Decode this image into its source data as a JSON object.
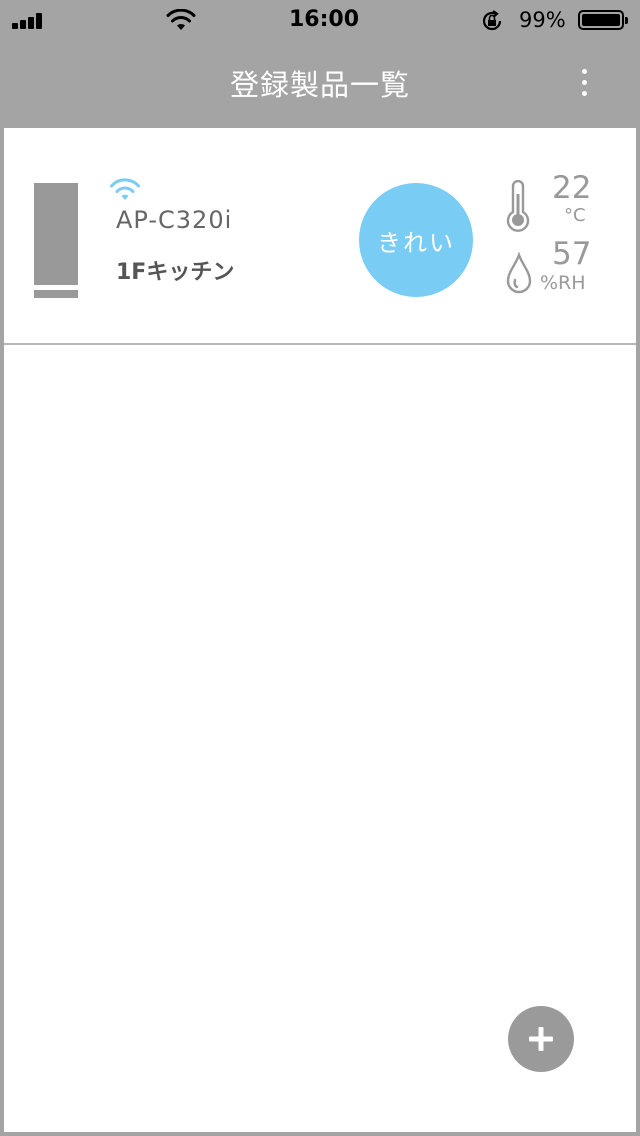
{
  "status_bar": {
    "time": "16:00",
    "battery_percent": "99%",
    "battery_level": 0.99,
    "icons": [
      "signal-icon",
      "wifi-icon",
      "orientation-lock-icon",
      "battery-icon"
    ]
  },
  "navbar": {
    "title": "登録製品一覧",
    "menu_icon": "more-vertical-icon"
  },
  "devices": [
    {
      "model": "AP-C320i",
      "location": "1Fキッチン",
      "status_label": "きれい",
      "status_color": "#79ccf4",
      "temperature": "22",
      "temperature_unit": "°C",
      "humidity": "57",
      "humidity_unit": "%RH",
      "connection_icon": "wifi-icon"
    }
  ],
  "add_button": {
    "icon": "plus-icon"
  },
  "colors": {
    "background": "#a4a4a4",
    "panel": "#ffffff",
    "accent": "#79ccf4",
    "muted": "#999999"
  }
}
